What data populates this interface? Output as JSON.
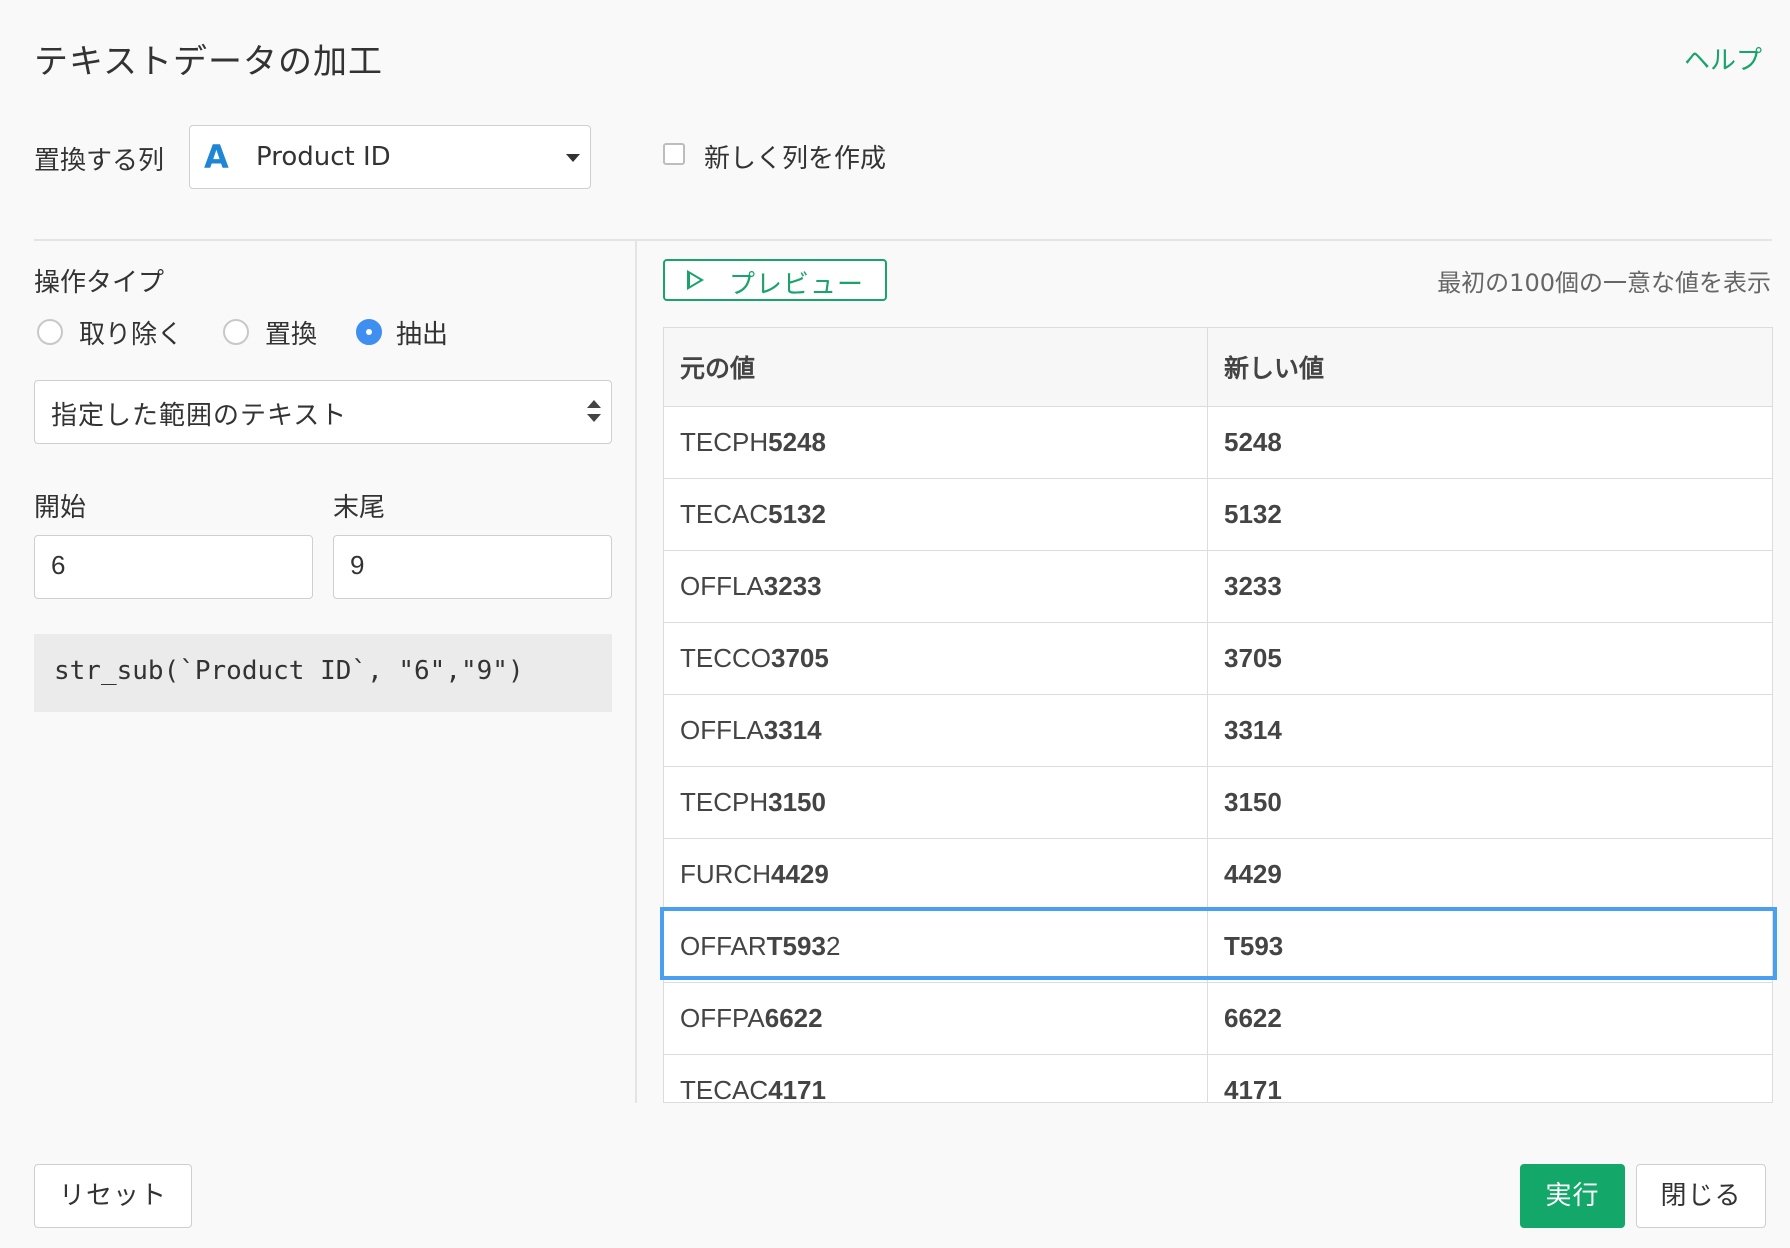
{
  "dialog": {
    "title": "テキストデータの加工",
    "help": "ヘルプ"
  },
  "column_select": {
    "label": "置換する列",
    "type_icon": "A",
    "value": "Product ID"
  },
  "new_column": {
    "label": "新しく列を作成",
    "checked": false
  },
  "operation": {
    "label": "操作タイプ",
    "options": [
      "取り除く",
      "置換",
      "抽出"
    ],
    "selected": "抽出",
    "method": "指定した範囲のテキスト"
  },
  "range": {
    "start_label": "開始",
    "end_label": "末尾",
    "start_value": "6",
    "end_value": "9"
  },
  "code": "str_sub(`Product ID`, \"6\",\"9\")",
  "preview": {
    "button": "プレビュー",
    "note": "最初の100個の一意な値を表示",
    "columns": [
      "元の値",
      "新しい値"
    ],
    "rows": [
      {
        "prefix": "TECPH",
        "bold": "5248",
        "suffix": "",
        "new": "5248"
      },
      {
        "prefix": "TECAC",
        "bold": "5132",
        "suffix": "",
        "new": "5132"
      },
      {
        "prefix": "OFFLA",
        "bold": "3233",
        "suffix": "",
        "new": "3233"
      },
      {
        "prefix": "TECCO",
        "bold": "3705",
        "suffix": "",
        "new": "3705"
      },
      {
        "prefix": "OFFLA",
        "bold": "3314",
        "suffix": "",
        "new": "3314"
      },
      {
        "prefix": "TECPH",
        "bold": "3150",
        "suffix": "",
        "new": "3150"
      },
      {
        "prefix": "FURCH",
        "bold": "4429",
        "suffix": "",
        "new": "4429"
      },
      {
        "prefix": "OFFAR",
        "bold": "T593",
        "suffix": "2",
        "new": "T593"
      },
      {
        "prefix": "OFFPA",
        "bold": "6622",
        "suffix": "",
        "new": "6622"
      },
      {
        "prefix": "TECAC",
        "bold": "4171",
        "suffix": "",
        "new": "4171"
      }
    ]
  },
  "footer": {
    "reset": "リセット",
    "run": "実行",
    "close": "閉じる"
  }
}
